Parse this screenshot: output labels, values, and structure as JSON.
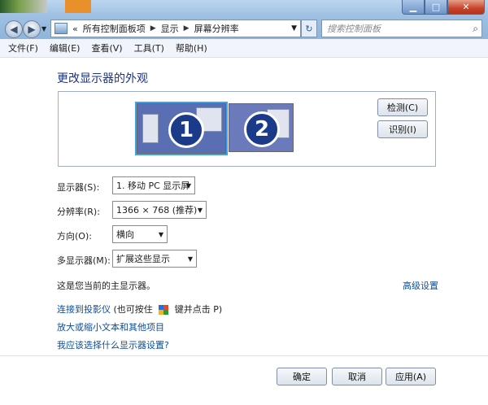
{
  "address": {
    "segments": [
      "所有控制面板项",
      "显示",
      "屏幕分辨率"
    ],
    "prefix": "«"
  },
  "search": {
    "placeholder": "搜索控制面板"
  },
  "menu": [
    "文件(F)",
    "编辑(E)",
    "查看(V)",
    "工具(T)",
    "帮助(H)"
  ],
  "page": {
    "title": "更改显示器的外观"
  },
  "monitors": [
    {
      "number": "1"
    },
    {
      "number": "2"
    }
  ],
  "buttons": {
    "detect": "检测(C)",
    "identify": "识别(I)",
    "ok": "确定",
    "cancel": "取消",
    "apply": "应用(A)"
  },
  "settings": {
    "display_label": "显示器(S):",
    "display_value": "1. 移动 PC 显示屏",
    "resolution_label": "分辨率(R):",
    "resolution_value": "1366 × 768 (推荐)",
    "orientation_label": "方向(O):",
    "orientation_value": "横向",
    "multi_label": "多显示器(M):",
    "multi_value": "扩展这些显示"
  },
  "status_text": "这是您当前的主显示器。",
  "advanced_link": "高级设置",
  "projector": {
    "link": "连接到投影仪",
    "hint_pre": " (也可按住 ",
    "hint_post": " 键并点击 P)"
  },
  "links": [
    "放大或缩小文本和其他项目",
    "我应该选择什么显示器设置?"
  ]
}
